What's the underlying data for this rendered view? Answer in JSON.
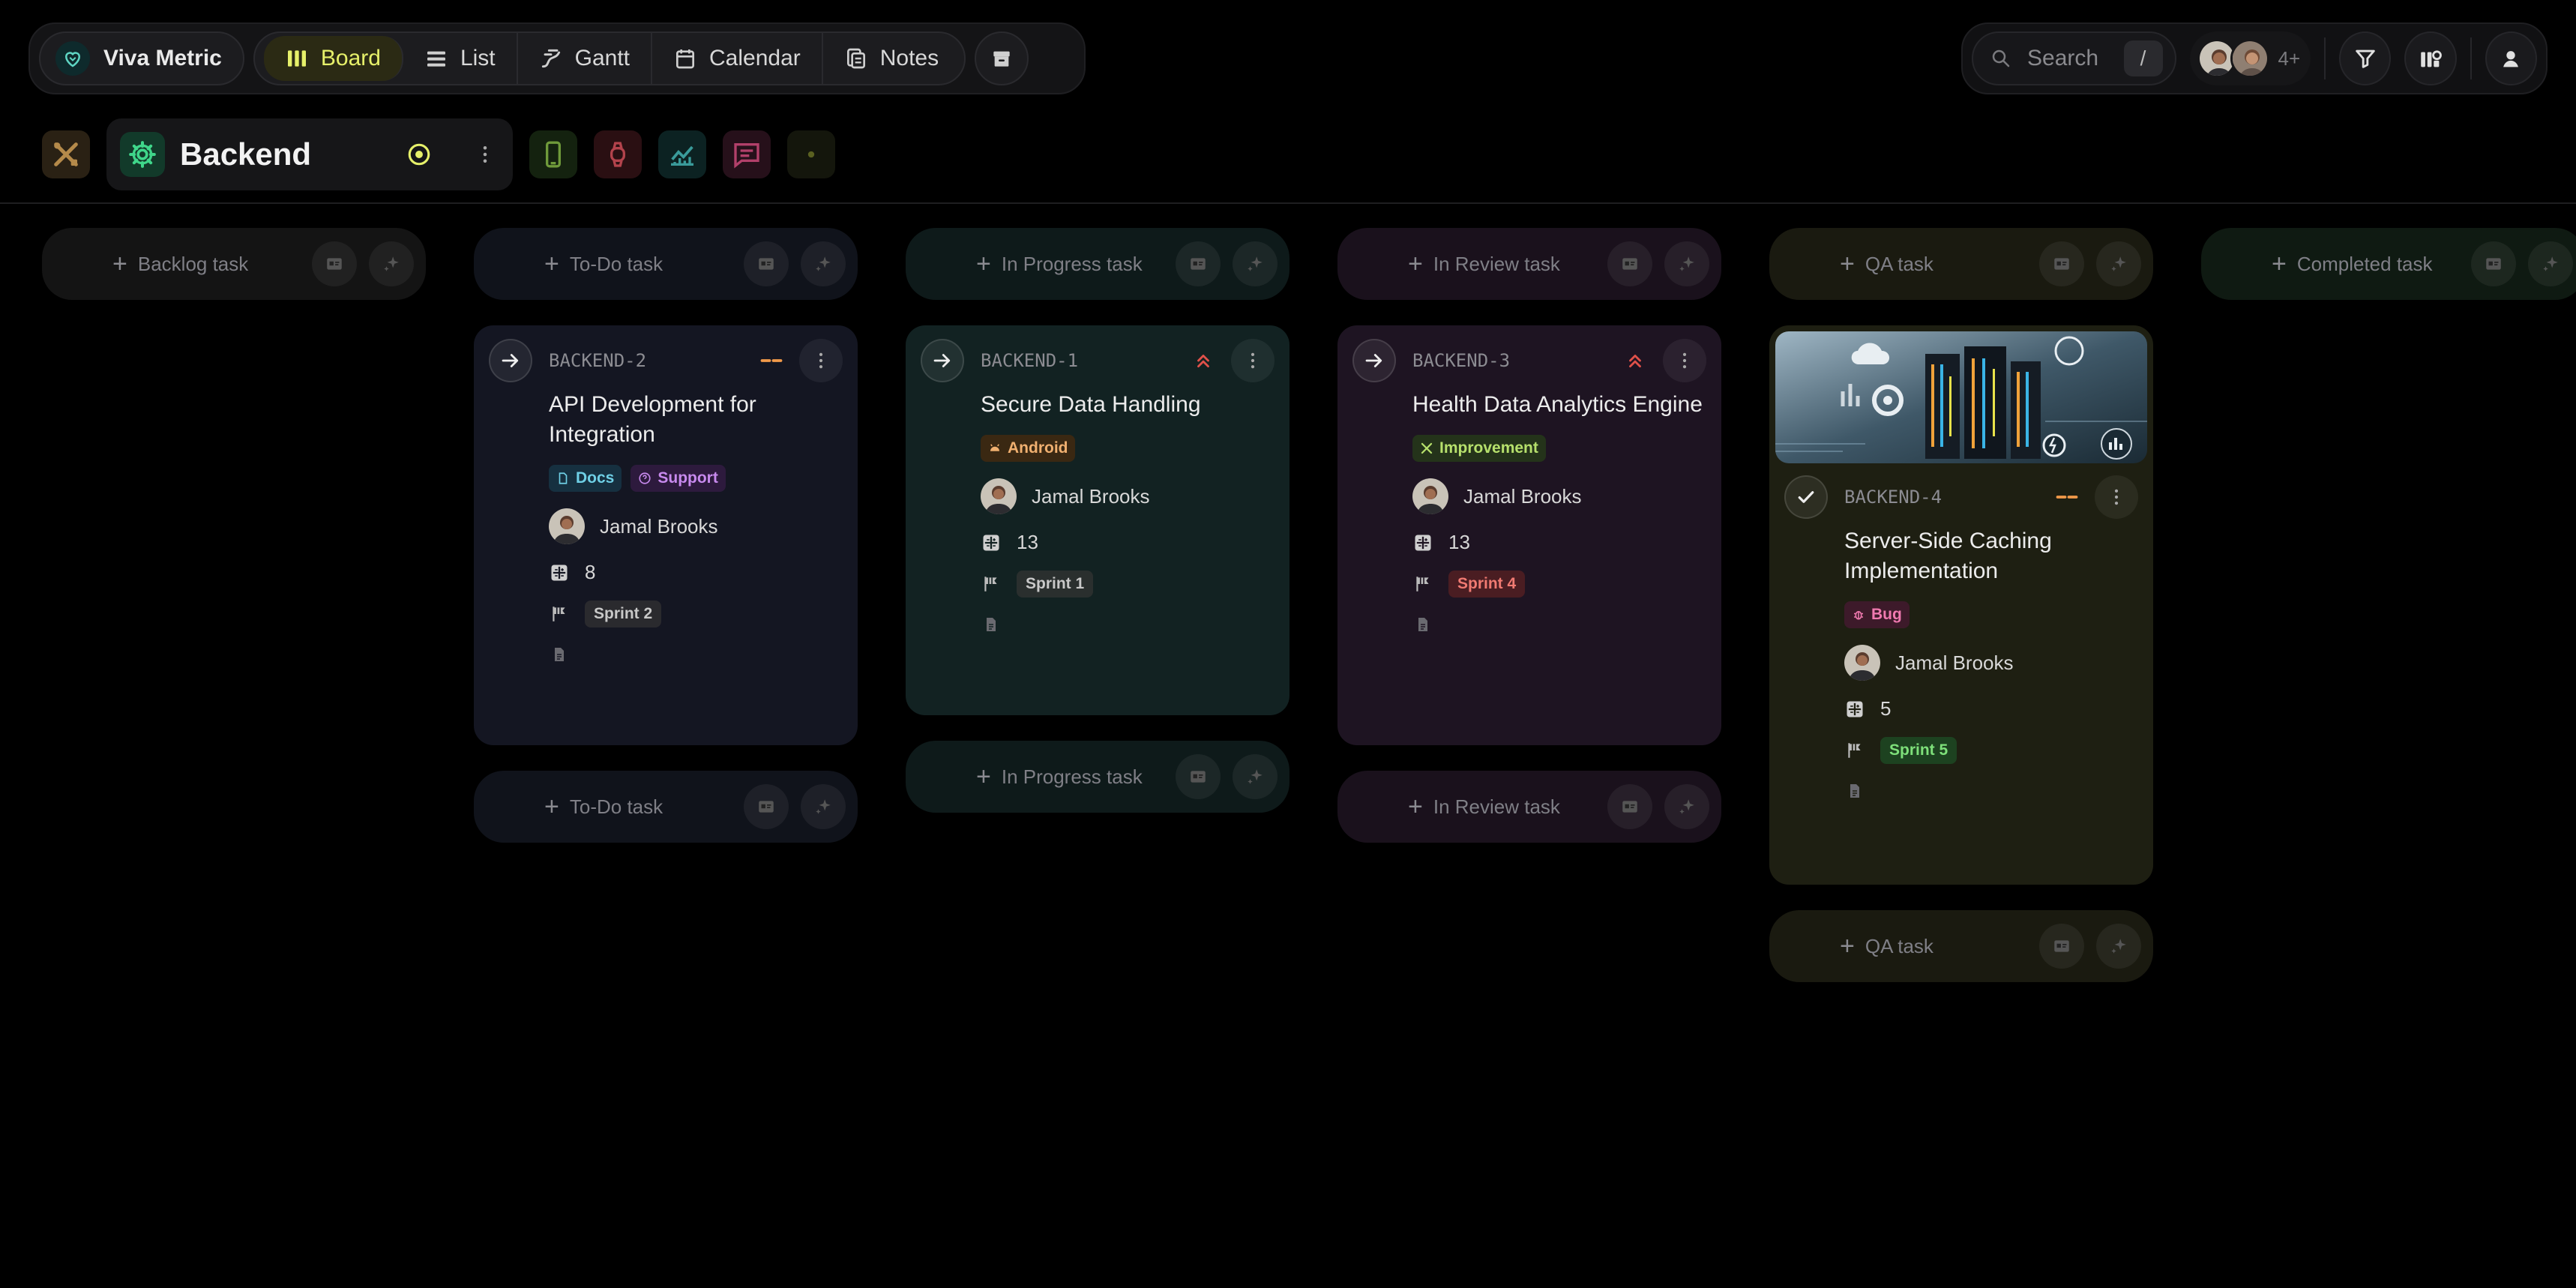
{
  "brand": {
    "name": "Viva Metric"
  },
  "views": [
    {
      "label": "Board",
      "icon": "board-icon",
      "active": true
    },
    {
      "label": "List",
      "icon": "list-icon"
    },
    {
      "label": "Gantt",
      "icon": "gantt-icon"
    },
    {
      "label": "Calendar",
      "icon": "calendar-icon"
    },
    {
      "label": "Notes",
      "icon": "notes-icon"
    }
  ],
  "search": {
    "placeholder": "Search",
    "shortcut": "/"
  },
  "members": {
    "more": "4+"
  },
  "project": {
    "name": "Backend"
  },
  "columns": [
    {
      "add_label": "Backlog task"
    },
    {
      "add_label": "To-Do task"
    },
    {
      "add_label": "In Progress task"
    },
    {
      "add_label": "In Review task"
    },
    {
      "add_label": "QA task"
    },
    {
      "add_label": "Completed task"
    }
  ],
  "cards": [
    {
      "key": "BACKEND-2",
      "title": "API Development for Integration",
      "priority": "medium",
      "tags": [
        {
          "label": "Docs",
          "color": "#4fb4c8"
        },
        {
          "label": "Support",
          "color": "#b778e0"
        }
      ],
      "assignee": "Jamal Brooks",
      "points": "8",
      "sprint": "Sprint 2"
    },
    {
      "key": "BACKEND-1",
      "title": "Secure Data Handling",
      "priority": "high",
      "tags": [
        {
          "label": "Android",
          "color": "#e0a76a"
        }
      ],
      "assignee": "Jamal Brooks",
      "points": "13",
      "sprint": "Sprint 1"
    },
    {
      "key": "BACKEND-3",
      "title": "Health Data Analytics Engine",
      "priority": "high",
      "tags": [
        {
          "label": "Improvement",
          "color": "#a6d25a"
        }
      ],
      "assignee": "Jamal Brooks",
      "points": "13",
      "sprint": "Sprint 4"
    },
    {
      "key": "BACKEND-4",
      "title": "Server-Side Caching Implementation",
      "priority": "medium",
      "tags": [
        {
          "label": "Bug",
          "color": "#e56aa0"
        }
      ],
      "assignee": "Jamal Brooks",
      "points": "5",
      "sprint": "Sprint 5",
      "done": true
    }
  ],
  "colors": {
    "accent": "#e6f06a",
    "high": "#e0514a",
    "medium": "#f29a4a"
  }
}
